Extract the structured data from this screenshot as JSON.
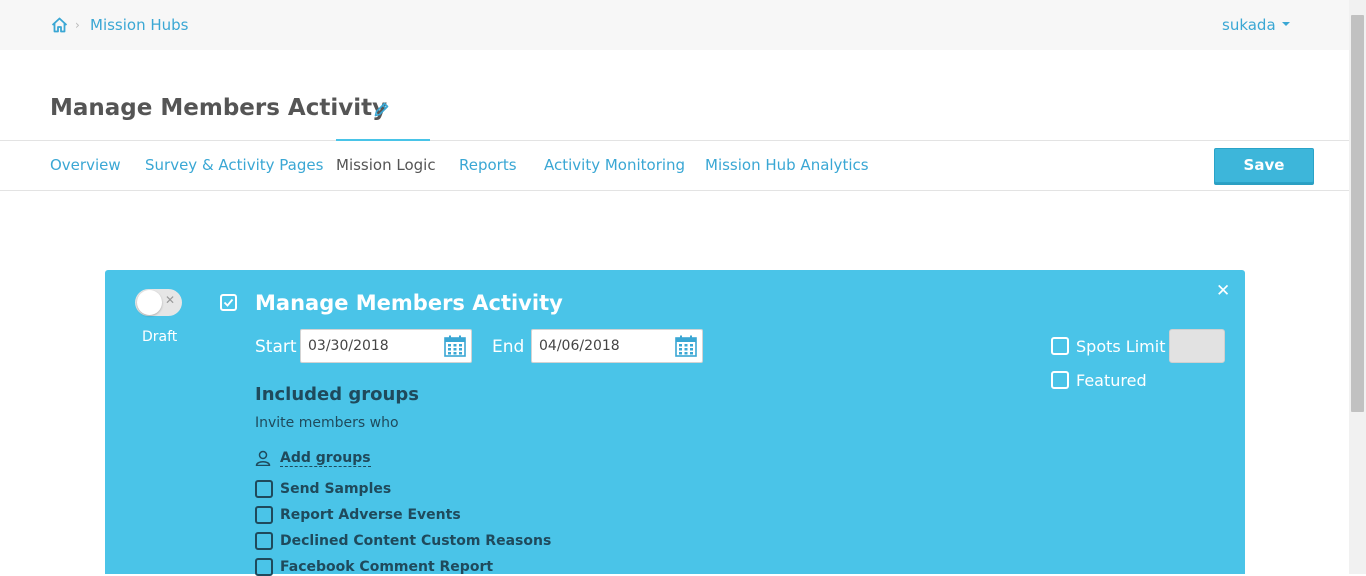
{
  "breadcrumb": {
    "home_icon": "home-icon",
    "items": [
      "Mission Hubs"
    ]
  },
  "user_menu": {
    "username": "sukada"
  },
  "header": {
    "title": "Manage Members Activity",
    "edit_icon": "pencil-icon"
  },
  "tabs": [
    {
      "label": "Overview",
      "active": false
    },
    {
      "label": "Survey & Activity Pages",
      "active": false
    },
    {
      "label": "Mission Logic",
      "active": true
    },
    {
      "label": "Reports",
      "active": false
    },
    {
      "label": "Activity Monitoring",
      "active": false
    },
    {
      "label": "Mission Hub Analytics",
      "active": false
    }
  ],
  "toolbar": {
    "save_label": "Save"
  },
  "activity": {
    "toggle_state": "off",
    "toggle_label": "Draft",
    "selected": true,
    "title": "Manage Members Activity",
    "start_label": "Start",
    "start_date": "03/30/2018",
    "end_label": "End",
    "end_date": "04/06/2018",
    "spots_limit_label": "Spots Limit",
    "spots_limit_checked": false,
    "featured_label": "Featured",
    "featured_checked": false,
    "included_groups_heading": "Included groups",
    "invite_text": "Invite members who",
    "add_groups_label": "Add groups",
    "groups": [
      {
        "label": "Send Samples",
        "checked": false
      },
      {
        "label": "Report Adverse Events",
        "checked": false
      },
      {
        "label": "Declined Content Custom Reasons",
        "checked": false
      },
      {
        "label": "Facebook Comment Report",
        "checked": false
      }
    ]
  },
  "colors": {
    "accent": "#3aa7d4",
    "panel": "#4ac4e8",
    "dark_text": "#1f4a5c",
    "save_button": "#3db6da"
  }
}
